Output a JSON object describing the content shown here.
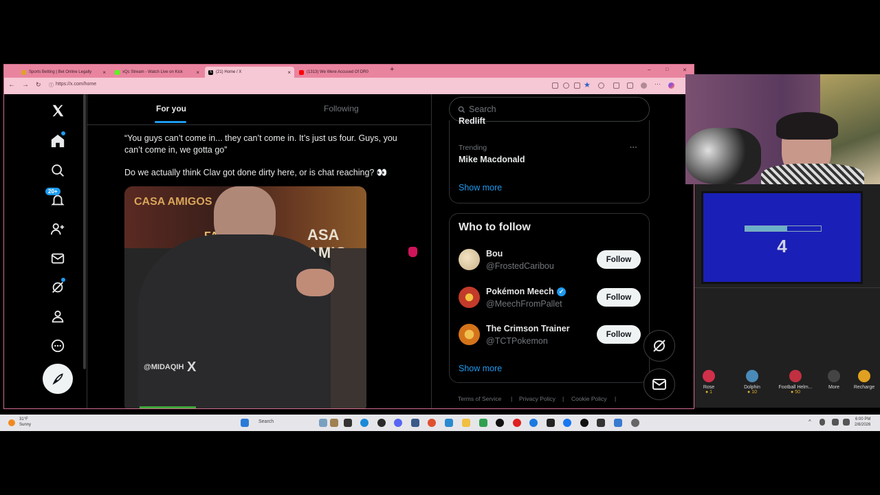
{
  "browser": {
    "tabs": [
      {
        "label": "Sports Betting | Bet Online Legally",
        "color": "#e0a030"
      },
      {
        "label": "xQc Stream - Watch Live on Kick",
        "color": "#53fc18"
      },
      {
        "label": "(21) Home / X",
        "color": "#000000"
      },
      {
        "label": "(1313) We Were Accused Of DR0",
        "color": "#ff0000"
      }
    ],
    "new_tab": "+",
    "url": "https://x.com/home",
    "minimize": "–",
    "maximize": "□",
    "close": "✕"
  },
  "x": {
    "tabs": {
      "for_you": "For you",
      "following": "Following"
    },
    "notification_badge": "20+",
    "post": {
      "line1": "“You guys can’t come in... they can’t come in. It’s just us four. Guys, you",
      "line2": "can’t come in, we gotta go”",
      "line3": "Do we actually think Clav got done dirty here, or is chat reaching? 👀",
      "watermark": "@MIDAQIH",
      "signs": [
        "CASA AMIGOS",
        "FAS",
        "ASA AMIG"
      ]
    },
    "search": {
      "placeholder": "Search"
    },
    "trending": {
      "partial_title": "Redlift",
      "label": "Trending",
      "topic": "Mike Macdonald",
      "more_icon": "···",
      "show_more": "Show more"
    },
    "who_to_follow": {
      "title": "Who to follow",
      "users": [
        {
          "name": "Bou",
          "handle": "@FrostedCaribou",
          "button": "Follow",
          "verified": false,
          "avatar_color": "#c9b48a"
        },
        {
          "name": "Pokémon Meech",
          "handle": "@MeechFromPallet",
          "button": "Follow",
          "verified": true,
          "avatar_color": "#c23a2a"
        },
        {
          "name": "The Crimson Trainer",
          "handle": "@TCTPokemon",
          "button": "Follow",
          "verified": false,
          "avatar_color": "#d4731a"
        }
      ],
      "show_more": "Show more"
    },
    "footer": [
      "Terms of Service",
      "Privacy Policy",
      "Cookie Policy"
    ],
    "footer_sep": "|"
  },
  "stream": {
    "counter": "4",
    "progress": 0.55,
    "gifts": [
      {
        "name": "Rose",
        "price": "1",
        "color": "#d0304a"
      },
      {
        "name": "Dolphin",
        "price": "10",
        "color": "#4a8ab8"
      },
      {
        "name": "Football Helm...",
        "price": "50",
        "color": "#c03040"
      },
      {
        "name": "More",
        "price": "",
        "color": "#555555"
      },
      {
        "name": "Recharge",
        "price": "",
        "color": "#e0a020"
      }
    ]
  },
  "taskbar": {
    "weather_temp": "31°F",
    "weather_desc": "Sunny",
    "search": "Search",
    "time": "6:00 PM",
    "date": "2/8/2026"
  }
}
